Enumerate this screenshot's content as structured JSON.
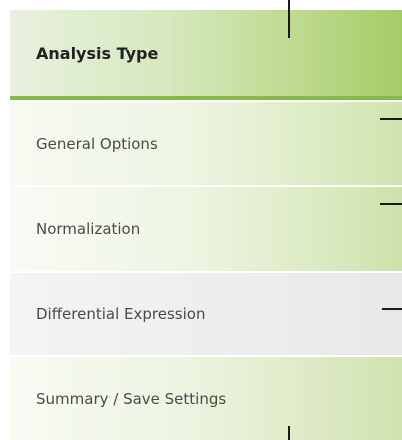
{
  "wizard": {
    "steps": [
      {
        "label": "Analysis Type",
        "active": true
      },
      {
        "label": "General Options",
        "active": false
      },
      {
        "label": "Normalization",
        "active": false
      },
      {
        "label": "Differential Expression",
        "active": false
      },
      {
        "label": "Summary / Save Settings",
        "active": false
      }
    ]
  },
  "colors": {
    "active_accent": "#86b84a",
    "active_gradient_end": "#a4cc66",
    "inactive_text": "#4a4a4a",
    "active_text": "#222222"
  }
}
